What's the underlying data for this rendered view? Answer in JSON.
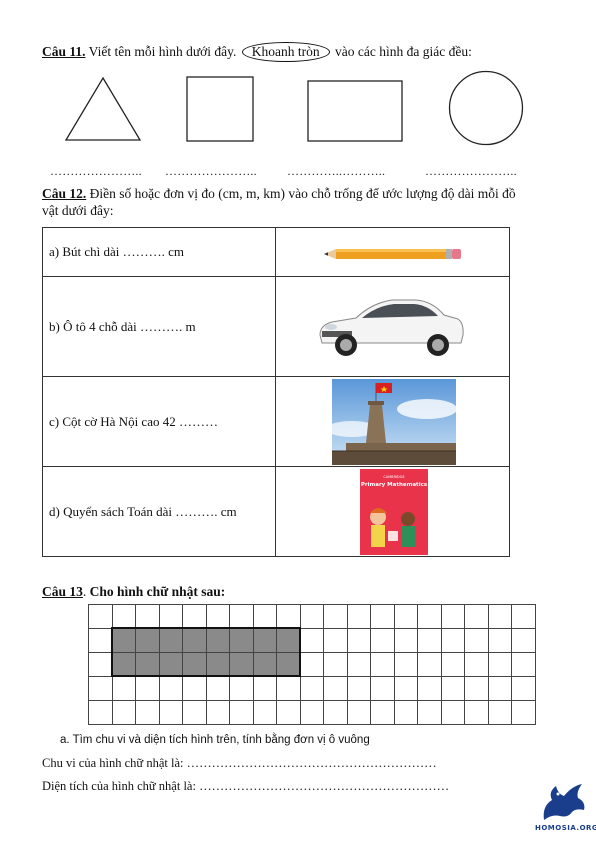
{
  "q11": {
    "num": "Câu 11.",
    "text_before": "Viết tên mỗi hình dưới đây.",
    "circled": "Khoanh tròn",
    "text_after": "vào các hình đa giác đều:",
    "blanks": [
      "…………………..",
      "…………………..",
      "…………..………..",
      "………………….."
    ],
    "shapes": [
      "triangle-icon",
      "square-icon",
      "rectangle-icon",
      "circle-icon"
    ]
  },
  "q12": {
    "num": "Câu 12.",
    "text_line1": "Điền số hoặc đơn vị đo (cm, m, km) vào chỗ trống để ước lượng độ dài mỗi đồ",
    "text_line2": "vật dưới đây:",
    "rows": [
      {
        "text": "a) Bút chì dài ………. cm",
        "image": "pencil-image"
      },
      {
        "text": "b) Ô tô 4 chỗ dài ………. m",
        "image": "car-image"
      },
      {
        "text": "c) Cột cờ Hà Nội cao 42 ………",
        "image": "flag-tower-image"
      },
      {
        "text": "d) Quyển sách Toán dài ………. cm",
        "image": "math-book-image"
      }
    ],
    "book_title": "Primary Mathematics",
    "book_brand": "CAMBRIDGE"
  },
  "q13": {
    "num": "Câu 13",
    "dot": ".",
    "title": "Cho hình chữ nhật sau:",
    "grid": {
      "rows": 5,
      "cols": 19,
      "filled_rows": [
        1,
        2
      ],
      "filled_cols": [
        1,
        8
      ]
    },
    "item_a": "a.   Tìm chu vi và diện tích hình trên, tính bằng đơn vị ô vuông",
    "perimeter_line": "Chu vi của hình chữ nhật là: ……………………………………………………",
    "area_line": "Diện tích của hình chữ nhật là: ……………………………………………………"
  },
  "logo": {
    "text": "HOMOSIA.ORG",
    "color": "#1a3e8c"
  }
}
